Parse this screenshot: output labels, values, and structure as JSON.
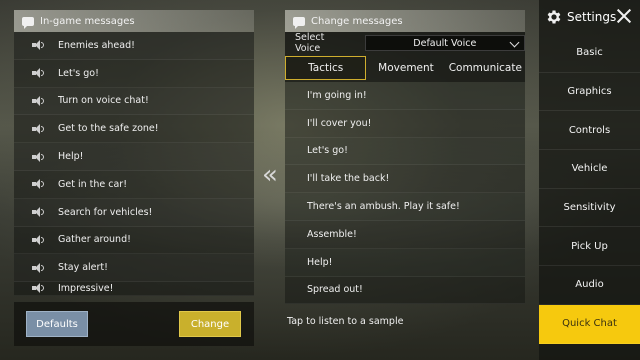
{
  "left_panel": {
    "header": "In-game messages",
    "messages": [
      "Enemies ahead!",
      "Let's go!",
      "Turn on voice chat!",
      "Get to the safe zone!",
      "Help!",
      "Get in the car!",
      "Search for vehicles!",
      "Gather around!",
      "Stay alert!",
      "Impressive!"
    ],
    "defaults_label": "Defaults",
    "change_label": "Change"
  },
  "transfer_arrow": "«",
  "right_panel": {
    "header": "Change messages",
    "voice_label": "Select Voice",
    "voice_value": "Default Voice",
    "tabs": [
      "Tactics",
      "Movement",
      "Communicate"
    ],
    "active_tab": "Tactics",
    "messages": [
      "I'm going in!",
      "I'll cover you!",
      "Let's go!",
      "I'll take the back!",
      "There's an ambush. Play it safe!",
      "Assemble!",
      "Help!",
      "Spread out!"
    ],
    "hint": "Tap to listen to a sample"
  },
  "sidebar": {
    "title": "Settings",
    "items": [
      "Basic",
      "Graphics",
      "Controls",
      "Vehicle",
      "Sensitivity",
      "Pick Up",
      "Audio",
      "Quick Chat"
    ],
    "active_item": "Quick Chat"
  },
  "colors": {
    "accent_yellow": "#f6c90e",
    "change_button": "#c9b02c",
    "defaults_button": "#7a8fa6",
    "tab_border": "#cfae2e"
  },
  "icons": [
    "chat-bubble-icon",
    "speaker-icon",
    "gear-icon",
    "close-icon",
    "chevron-down-icon",
    "double-left-arrow-icon"
  ]
}
